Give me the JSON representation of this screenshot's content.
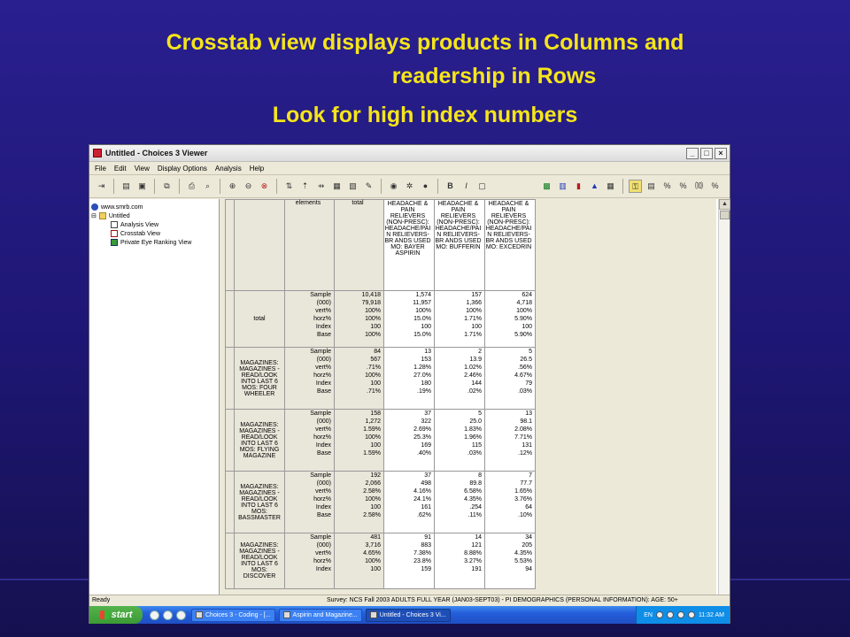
{
  "slide": {
    "title_line1": "Crosstab view displays products in Columns and",
    "title_line2": "readership in Rows",
    "title_line3": "Look for high index numbers"
  },
  "window": {
    "title": "Untitled - Choices 3 Viewer",
    "min": "_",
    "max": "□",
    "close": "×"
  },
  "menu": [
    "File",
    "Edit",
    "View",
    "Display Options",
    "Analysis",
    "Help"
  ],
  "tree": {
    "root": "www.smrb.com",
    "folder": "Untitled",
    "items": [
      "Analysis View",
      "Crosstab View",
      "Private Eye Ranking View"
    ]
  },
  "crosstab": {
    "header_elements": "elements",
    "header_total": "total",
    "columns": [
      "HEADACHE & PAIN RELIEVERS (NON-PRESC): HEADACHE/PAI N RELIEVERS-BR ANDS USED MO: BAYER ASPIRIN",
      "HEADACHE & PAIN RELIEVERS (NON-PRESC): HEADACHE/PAI N RELIEVERS-BR ANDS USED MO: BUFFERIN",
      "HEADACHE & PAIN RELIEVERS (NON-PRESC): HEADACHE/PAI N RELIEVERS-BR ANDS USED MO: EXCEDRIN"
    ],
    "element_labels": [
      "Sample",
      "(000)",
      "vert%",
      "horz%",
      "Index",
      "Base"
    ],
    "rows": [
      {
        "label": "total",
        "total": [
          "10,418",
          "79,918",
          "100%",
          "100%",
          "100",
          "100%"
        ],
        "cols": [
          [
            "1,574",
            "11,957",
            "100%",
            "15.0%",
            "100",
            "15.0%"
          ],
          [
            "157",
            "1,366",
            "100%",
            "1.71%",
            "100",
            "1.71%"
          ],
          [
            "624",
            "4,718",
            "100%",
            "5.90%",
            "100",
            "5.90%"
          ]
        ]
      },
      {
        "label": "MAGAZINES: MAGAZINES - READ/LOOK INTO LAST 6 MOS: FOUR WHEELER",
        "total": [
          "84",
          "567",
          ".71%",
          "100%",
          "100",
          ".71%"
        ],
        "cols": [
          [
            "13",
            "153",
            "1.28%",
            "27.0%",
            "180",
            ".19%"
          ],
          [
            "2",
            "13.9",
            "1.02%",
            "2.46%",
            "144",
            ".02%"
          ],
          [
            "5",
            "26.5",
            ".56%",
            "4.67%",
            "79",
            ".03%"
          ]
        ]
      },
      {
        "label": "MAGAZINES: MAGAZINES - READ/LOOK INTO LAST 6 MOS: FLYING MAGAZINE",
        "total": [
          "158",
          "1,272",
          "1.59%",
          "100%",
          "100",
          "1.59%"
        ],
        "cols": [
          [
            "37",
            "322",
            "2.69%",
            "25.3%",
            "169",
            ".40%"
          ],
          [
            "5",
            "25.0",
            "1.83%",
            "1.96%",
            "115",
            ".03%"
          ],
          [
            "13",
            "98.1",
            "2.08%",
            "7.71%",
            "131",
            ".12%"
          ]
        ]
      },
      {
        "label": "MAGAZINES: MAGAZINES - READ/LOOK INTO LAST 6 MOS: BASSMASTER",
        "total": [
          "192",
          "2,066",
          "2.58%",
          "100%",
          "100",
          "2.58%"
        ],
        "cols": [
          [
            "37",
            "498",
            "4.16%",
            "24.1%",
            "161",
            ".62%"
          ],
          [
            "8",
            "89.8",
            "6.58%",
            "4.35%",
            ".254",
            ".11%"
          ],
          [
            "7",
            "77.7",
            "1.65%",
            "3.76%",
            "64",
            ".10%"
          ]
        ]
      },
      {
        "label": "MAGAZINES: MAGAZINES - READ/LOOK INTO LAST 6 MOS: DISCOVER",
        "total": [
          "481",
          "3,716",
          "4.65%",
          "100%",
          "100"
        ],
        "cols": [
          [
            "91",
            "883",
            "7.38%",
            "23.8%",
            "159"
          ],
          [
            "14",
            "121",
            "8.88%",
            "3.27%",
            "191"
          ],
          [
            "34",
            "205",
            "4.35%",
            "5.53%",
            "94"
          ]
        ]
      }
    ]
  },
  "status": {
    "left": "Ready",
    "survey": "Survey: NCS Fall 2003 ADULTS FULL YEAR (JAN03-SEPT03) - PI DEMOGRAPHICS (PERSONAL INFORMATION): AGE: 50+"
  },
  "taskbar": {
    "start": "start",
    "tasks": [
      "Choices 3 - Coding - [...",
      "Aspirin and Magazine...",
      "Untitled - Choices 3 Vi..."
    ],
    "lang": "EN",
    "time": "11:32 AM"
  }
}
